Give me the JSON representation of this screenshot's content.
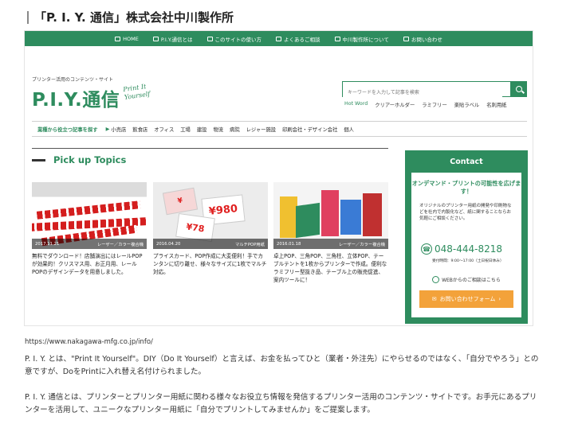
{
  "page_title": "「P. I. Y. 通信」株式会社中川製作所",
  "nav": [
    {
      "label": "HOME",
      "icon": "home-icon"
    },
    {
      "label": "P.I.Y.通信とは",
      "icon": "p-icon"
    },
    {
      "label": "このサイトの使い方",
      "icon": "q-icon"
    },
    {
      "label": "よくあるご相談",
      "icon": "chat-icon"
    },
    {
      "label": "中川製作所について",
      "icon": "link-icon"
    },
    {
      "label": "お問い合わせ",
      "icon": "mail-icon"
    }
  ],
  "header": {
    "tagline": "プリンター活用のコンテンツ・サイト",
    "logo_latin": "P.I.Y.",
    "logo_kanji": "通信",
    "logo_script": [
      "Print It",
      "Yourself"
    ],
    "search_placeholder": "キーワードを入力して記事を検索",
    "quick_links": [
      "Hot Word",
      "クリアーホルダー",
      "ラミフリー",
      "楽貼ラベル",
      "名刺用紙"
    ]
  },
  "industry": {
    "label": "業種から役立つ記事を探す",
    "items": [
      "小売店",
      "飲食店",
      "オフィス",
      "工場",
      "建設",
      "物流",
      "病院",
      "レジャー施設",
      "印刷会社・デザイン会社",
      "個人"
    ]
  },
  "pickup": {
    "title": "Pick up Topics",
    "cards": [
      {
        "date": "2017.11.21",
        "category": "レーザー／カラー複合機",
        "text": "無料でダウンロード！店舗演出にはレールPOPが効果的！クリスマス用、お正月用、レールPOPのデザインデータを用意しました。"
      },
      {
        "date": "2016.04.20",
        "category": "マルチPOP用紙",
        "text": "プライスカード、POP作成に大変便利！手でカンタンに切り離せ、様々なサイズに1枚でマルチ対応。"
      },
      {
        "date": "2016.01.18",
        "category": "レーザー／カラー複合機",
        "text": "卓上POP、三角POP、三角柱、立体POP、テーブルテントを1枚からプリンターで作成。便利なラミフリー型抜き品、テーブル上の販売促進、案内ツールに！"
      }
    ]
  },
  "contact": {
    "title": "Contact",
    "lead": "オンデマンド・プリントの可能性を広げます！",
    "desc": "オリジナルのプリンター用紙の開発や印刷物などを社内で内製化など、紙に関することならお気軽にご相談ください。",
    "phone": "048-444-8218",
    "hours": "受付時間：9:00〜17:00（土日祝日休み）",
    "web": "WEBからのご相談はこちら",
    "button": "お問い合わせフォーム"
  },
  "url": "https://www.nakagawa-mfg.co.jp/info/",
  "paragraphs": [
    "P. I. Y. とは、\"Print It Yourself\"。DIY（Do It Yourself）と言えば、お金を払ってひと（業者・外注先）にやらせるのではなく、「自分でやろう」との意ですが、DoをPrintに入れ替え名付けられました。",
    "P. I. Y. 通信とは、プリンターとプリンター用紙に関わる様々なお役立ち情報を発信するプリンター活用のコンテンツ・サイトです。お手元にあるプリンターを活用して、ユニークなプリンター用紙に「自分でプリントしてみませんか」をご提案します。"
  ],
  "colors": {
    "brand_green": "#2e8c5e",
    "orange": "#f3a23a",
    "red": "#e02020"
  }
}
